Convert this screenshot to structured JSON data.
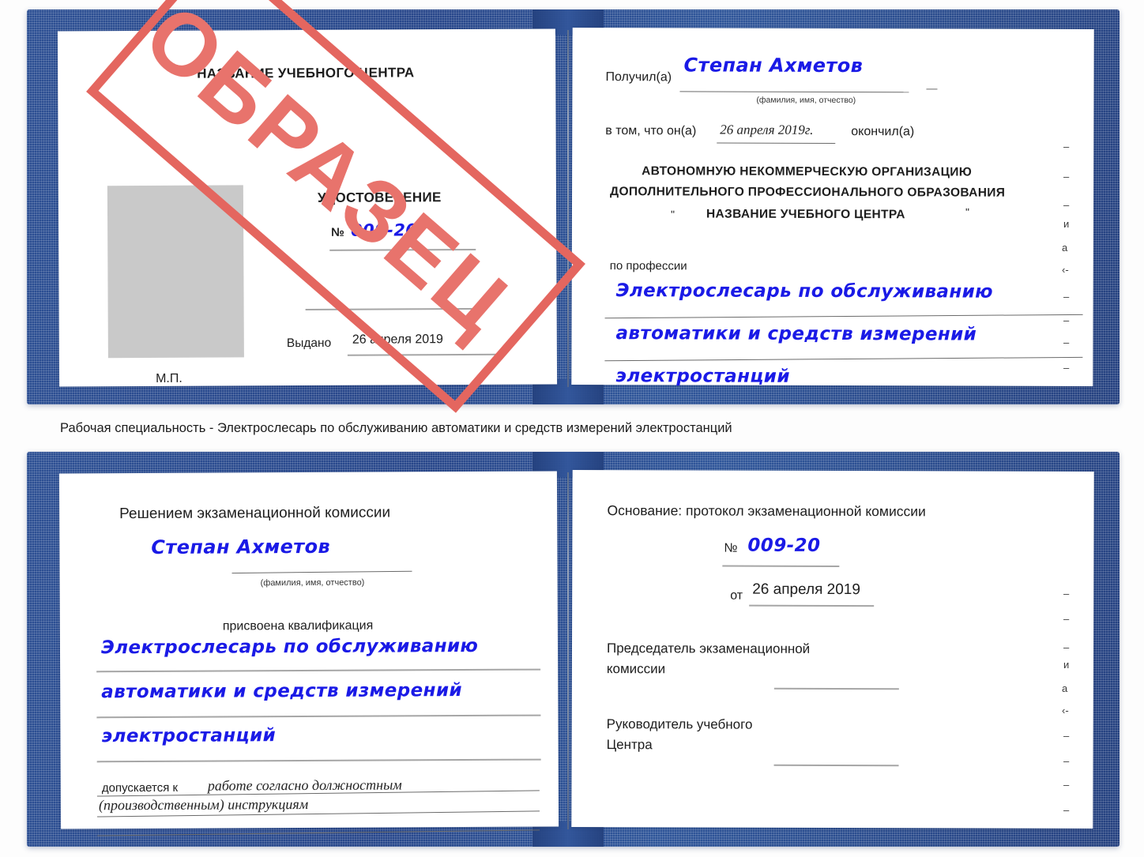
{
  "colors": {
    "cover_blue": "#2a4a8a",
    "handwriting_blue": "#1a1ae6",
    "watermark_red": "#e8736c",
    "photo_placeholder_gray": "#c9c9c9",
    "rule_gray": "#9a9a9a"
  },
  "watermark": {
    "label": "ОБРАЗЕЦ"
  },
  "caption": {
    "text": "Рабочая специальность - Электрослесарь по обслуживанию автоматики и средств измерений электростанций"
  },
  "certificate_front": {
    "left_page": {
      "center_name": "НАЗВАНИЕ УЧЕБНОГО ЦЕНТРА",
      "title": "УДОСТОВЕРЕНИЕ",
      "number_label": "№",
      "number_value": "009-20",
      "issued_label": "Выдано",
      "issued_value": "26 апреля 2019",
      "stamp_label": "М.П."
    },
    "right_page": {
      "received_label": "Получил(а)",
      "received_value": "Степан Ахметов",
      "fio_hint": "(фамилия, имя, отчество)",
      "in_that_label": "в том, что он(а)",
      "completion_date": "26 апреля 2019г.",
      "finished_label": "окончил(а)",
      "org_line1": "АВТОНОМНУЮ НЕКОММЕРЧЕСКУЮ ОРГАНИЗАЦИЮ",
      "org_line2": "ДОПОЛНИТЕЛЬНОГО ПРОФЕССИОНАЛЬНОГО ОБРАЗОВАНИЯ",
      "org_quote_open": "\"",
      "org_line3": "НАЗВАНИЕ УЧЕБНОГО ЦЕНТРА",
      "org_quote_close": "\"",
      "profession_label": "по профессии",
      "profession_line1": "Электрослесарь по обслуживанию",
      "profession_line2": "автоматики и средств измерений",
      "profession_line3": "электростанций",
      "margin_glyphs": [
        "–",
        "–",
        "–",
        "и",
        "а",
        "‹-",
        "–",
        "–",
        "–",
        "–"
      ]
    }
  },
  "certificate_inside": {
    "left_page": {
      "decision_title": "Решением экзаменационной комиссии",
      "name_value": "Степан Ахметов",
      "fio_hint": "(фамилия, имя, отчество)",
      "qualification_label": "присвоена квалификация",
      "qualification_line1": "Электрослесарь по обслуживанию",
      "qualification_line2": "автоматики и средств измерений",
      "qualification_line3": "электростанций",
      "admitted_label": "допускается к",
      "admitted_line1": "работе согласно должностным",
      "admitted_line2": "(производственным) инструкциям"
    },
    "right_page": {
      "basis_label": "Основание: протокол экзаменационной комиссии",
      "number_label": "№",
      "number_value": "009-20",
      "date_label": "от",
      "date_value": "26 апреля 2019",
      "chairman_line1": "Председатель экзаменационной",
      "chairman_line2": "комиссии",
      "head_line1": "Руководитель учебного",
      "head_line2": "Центра",
      "margin_glyphs": [
        "–",
        "–",
        "–",
        "и",
        "а",
        "‹-",
        "–",
        "–",
        "–",
        "–"
      ]
    }
  }
}
